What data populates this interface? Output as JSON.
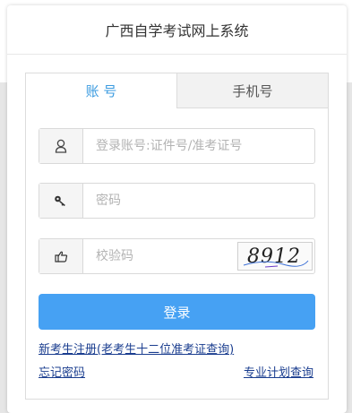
{
  "header": {
    "title": "广西自学考试网上系统"
  },
  "tabs": [
    {
      "label": "账 号",
      "active": true
    },
    {
      "label": "手机号",
      "active": false
    }
  ],
  "form": {
    "account": {
      "placeholder": "登录账号:证件号/准考证号",
      "value": "",
      "icon": "user-icon"
    },
    "password": {
      "placeholder": "密码",
      "value": "",
      "icon": "key-icon"
    },
    "captcha": {
      "placeholder": "校验码",
      "value": "",
      "icon": "hand-pointer-icon",
      "image_text": "8912"
    }
  },
  "login_button": {
    "label": "登录"
  },
  "links": {
    "register": "新考生注册(老考生十二位准考证查询)",
    "forgot_password": "忘记密码",
    "major_plan": "专业计划查询"
  },
  "colors": {
    "accent": "#46a1f3",
    "tab_active_text": "#3b9be0",
    "link": "#1a3d8f"
  }
}
